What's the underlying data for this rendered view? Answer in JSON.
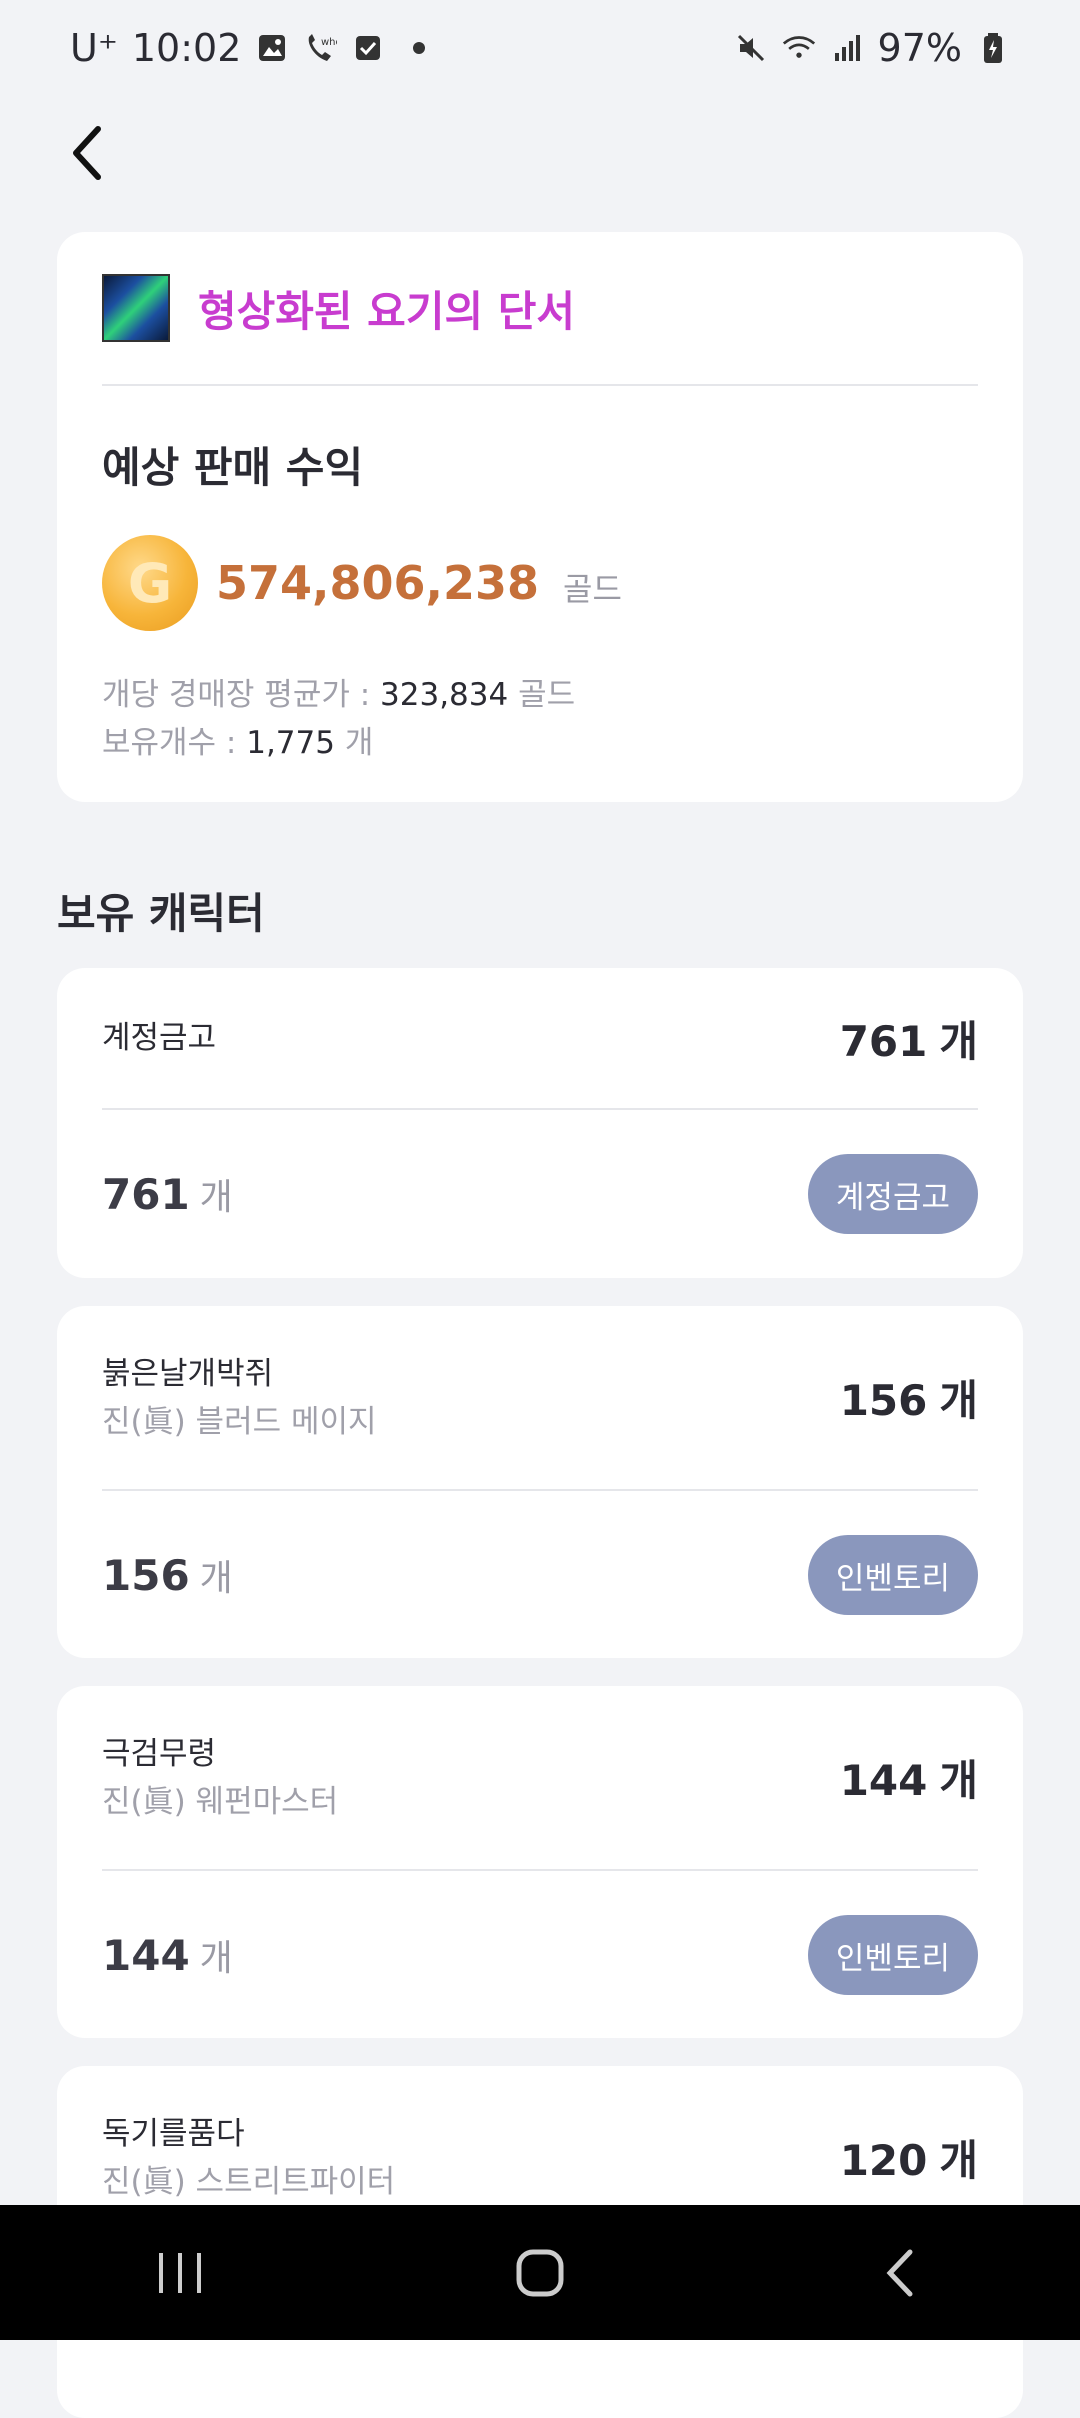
{
  "status_bar": {
    "carrier": "U⁺",
    "time": "10:02",
    "battery": "97%"
  },
  "item": {
    "name": "형상화된 요기의 단서",
    "section_title": "예상 판매 수익",
    "total_gold": "574,806,238",
    "gold_unit": "골드",
    "avg_price_label": "개당 경매장 평균가 : ",
    "avg_price_value": "323,834",
    "avg_price_unit": " 골드",
    "owned_label": "보유개수 : ",
    "owned_value": "1,775",
    "owned_unit": " 개"
  },
  "characters_title": "보유 캐릭터",
  "characters": [
    {
      "name": "계정금고",
      "class": "",
      "count": "761",
      "unit": "개",
      "location": "계정금고"
    },
    {
      "name": "붉은날개박쥐",
      "class": "진(眞) 블러드 메이지",
      "count": "156",
      "unit": "개",
      "location": "인벤토리"
    },
    {
      "name": "극검무령",
      "class": "진(眞) 웨펀마스터",
      "count": "144",
      "unit": "개",
      "location": "인벤토리"
    },
    {
      "name": "독기를품다",
      "class": "진(眞) 스트리트파이터",
      "count": "120",
      "unit": "개",
      "location": ""
    }
  ],
  "colors": {
    "item_name": "#c83ccf",
    "gold_value": "#c5703a",
    "location_button": "#8a97bd",
    "background": "#f2f3f6"
  }
}
